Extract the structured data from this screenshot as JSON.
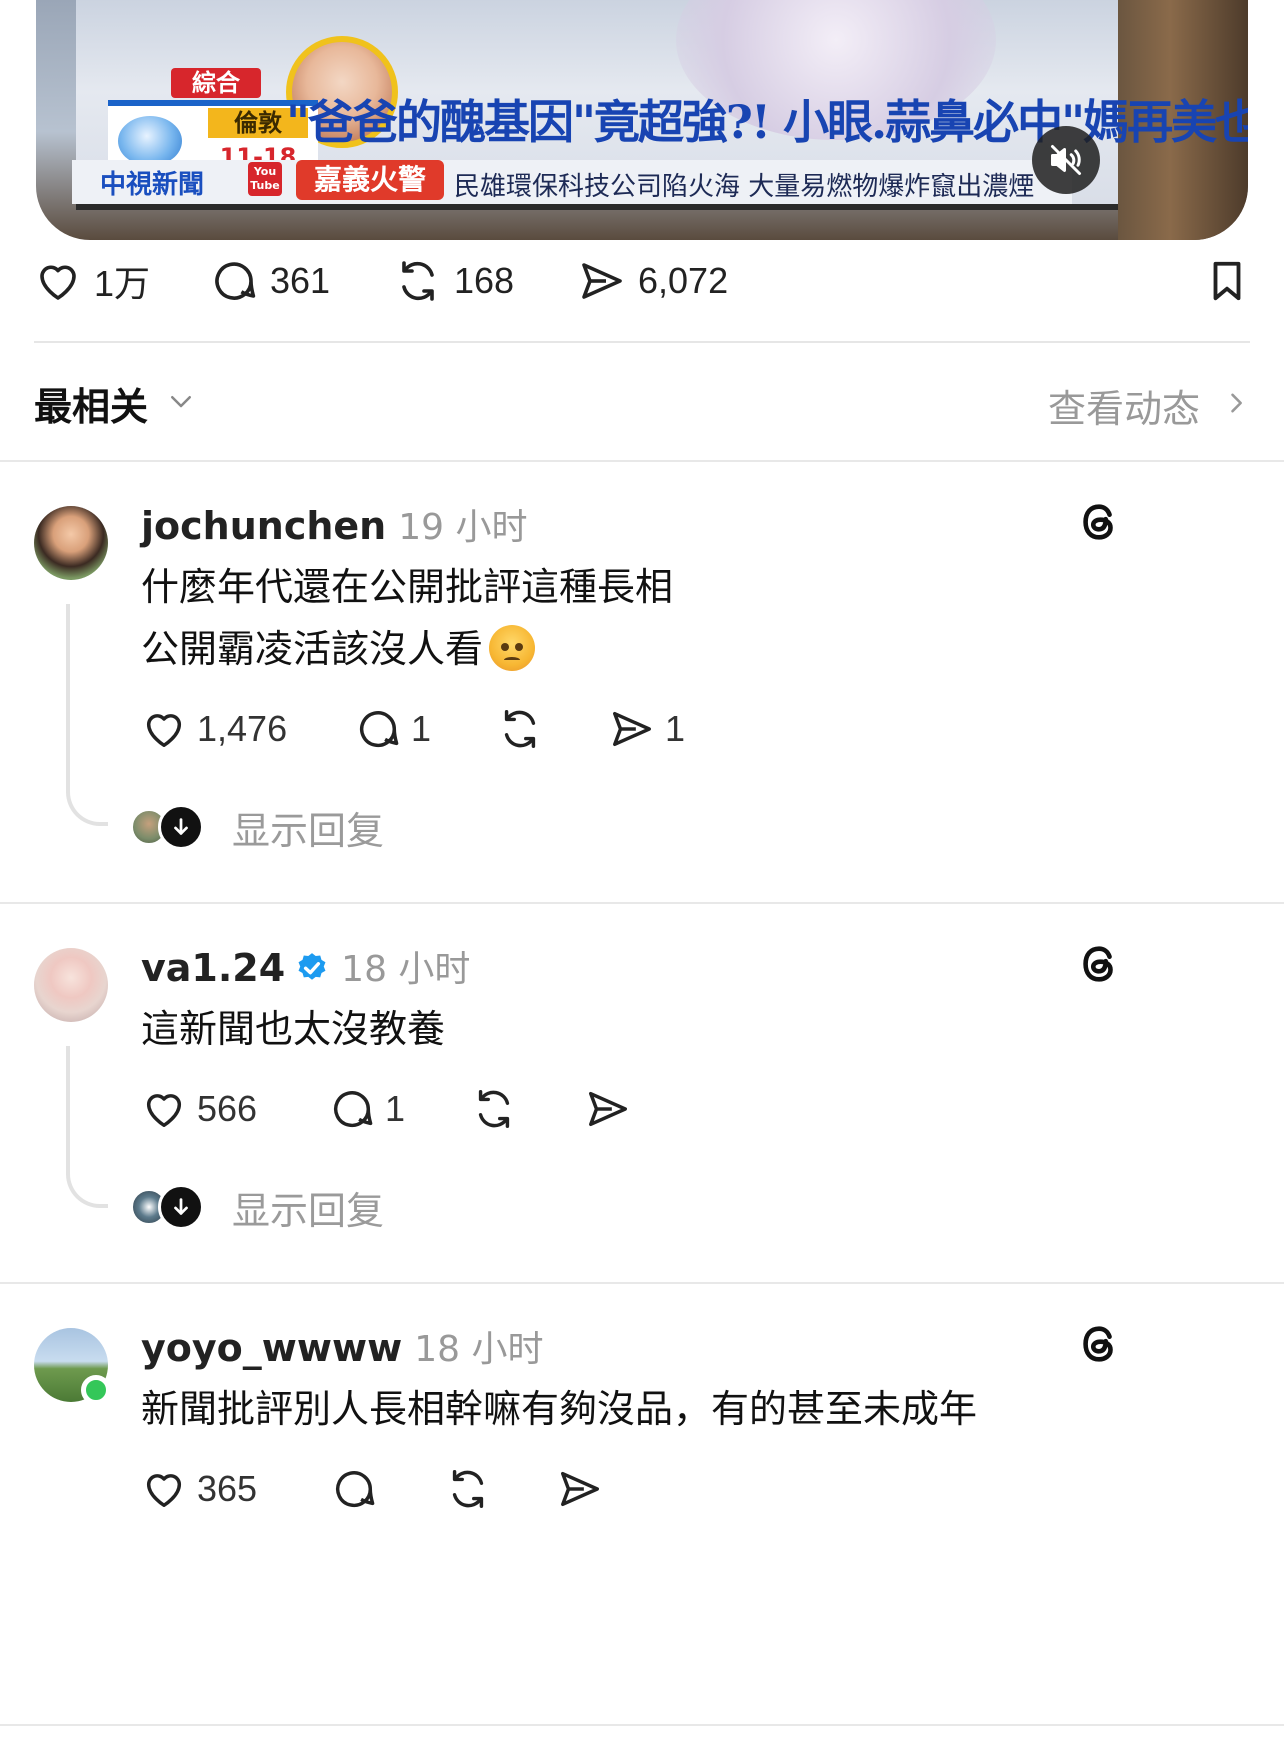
{
  "video": {
    "headline": "\"爸爸的醜基因\"竟超強?! 小眼.蒜鼻必中\"媽再美也沒用\"!",
    "section_tag": "綜合",
    "weather_city": "倫敦",
    "weather_date": "11-18",
    "brand": "中視新聞",
    "youtube_badge": "You Tube",
    "breaking_tag": "嘉義火警",
    "ticker": "民雄環保科技公司陷火海 大量易燃物爆炸竄出濃煙",
    "mute_icon": "speaker-muted-icon"
  },
  "post_actions": {
    "likes": "1万",
    "comments": "361",
    "reposts": "168",
    "shares": "6,072"
  },
  "sort": {
    "label": "最相关",
    "activity_link": "查看动态"
  },
  "comments": [
    {
      "username": "jochunchen",
      "time": "19 小时",
      "verified": false,
      "lines": [
        "什麼年代還在公開批評這種長相",
        "公開霸凌活該沒人看"
      ],
      "emoji": "angry-face",
      "likes": "1,476",
      "replies": "1",
      "reposts": "",
      "shares": "1",
      "show_replies": "显示回复"
    },
    {
      "username": "va1.24",
      "time": "18 小时",
      "verified": true,
      "lines": [
        "這新聞也太沒教養"
      ],
      "likes": "566",
      "replies": "1",
      "reposts": "",
      "shares": "",
      "show_replies": "显示回复"
    },
    {
      "username": "yoyo_wwww",
      "time": "18 小时",
      "verified": false,
      "online": true,
      "lines": [
        "新聞批評別人長相幹嘛有夠沒品，有的甚至未成年"
      ],
      "likes": "365",
      "replies": "",
      "reposts": "",
      "shares": ""
    }
  ],
  "colors": {
    "accent_verified": "#1d9bf0",
    "online": "#34c759",
    "muted_text": "#999999"
  }
}
